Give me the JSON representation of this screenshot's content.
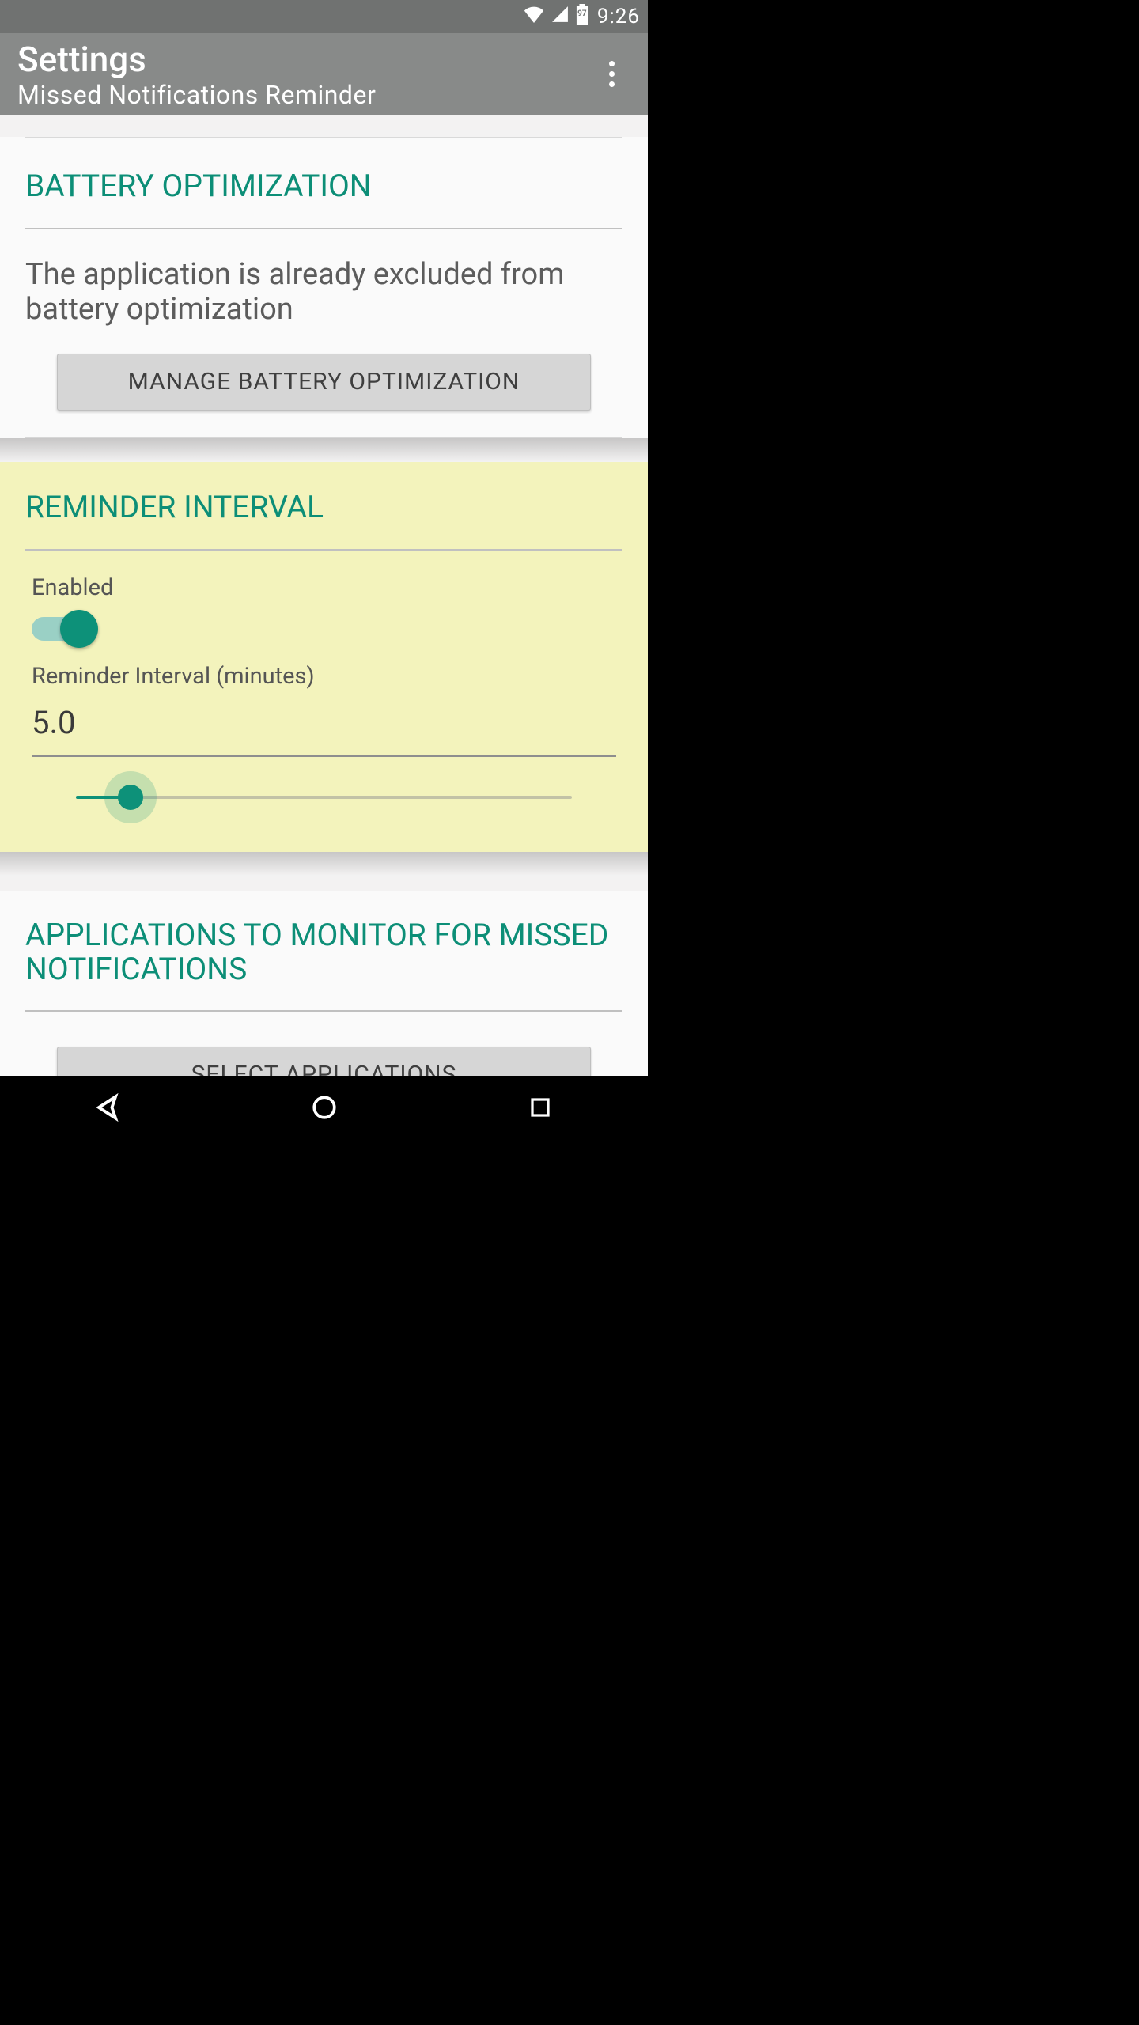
{
  "status": {
    "battery_level": "97",
    "time": "9:26"
  },
  "appbar": {
    "title": "Settings",
    "subtitle": "Missed Notifications Reminder"
  },
  "colors": {
    "accent": "#0c8e77",
    "highlight_bg": "#f3f3bc"
  },
  "battery_section": {
    "title": "BATTERY OPTIMIZATION",
    "body": "The application is already excluded from battery optimization",
    "button": "MANAGE BATTERY OPTIMIZATION"
  },
  "reminder_section": {
    "title": "REMINDER INTERVAL",
    "enabled_label": "Enabled",
    "enabled": true,
    "interval_label": "Reminder Interval (minutes)",
    "interval_value": "5.0",
    "slider_percent": 11
  },
  "apps_section": {
    "title": "APPLICATIONS TO MONITOR FOR MISSED NOTIFICATIONS",
    "button": "SELECT APPLICATIONS"
  }
}
